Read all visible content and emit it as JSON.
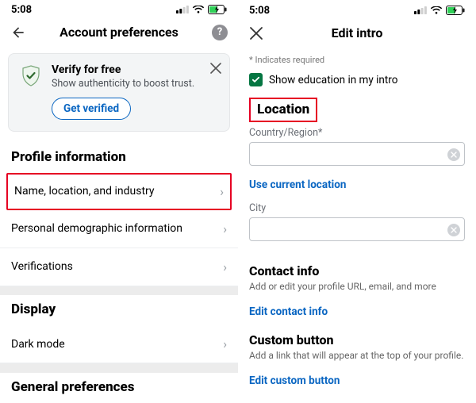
{
  "status_bar": {
    "time": "5:08"
  },
  "left": {
    "nav_title": "Account preferences",
    "verify": {
      "title": "Verify for free",
      "subtitle": "Show authenticity to boost trust.",
      "button": "Get verified"
    },
    "sections": {
      "profile_heading": "Profile information",
      "rows": {
        "name_location": "Name, location, and industry",
        "demographic": "Personal demographic information",
        "verifications": "Verifications"
      },
      "display_heading": "Display",
      "dark_mode": "Dark mode",
      "general_heading": "General preferences"
    }
  },
  "right": {
    "nav_title": "Edit intro",
    "required_note": "* Indicates required",
    "show_education_label": "Show education in my intro",
    "location_heading": "Location",
    "country_label": "Country/Region*",
    "country_value": "",
    "use_current_location": "Use current location",
    "city_label": "City",
    "city_value": "",
    "contact_heading": "Contact info",
    "contact_desc": "Add or edit your profile URL, email, and more",
    "edit_contact": "Edit contact info",
    "custom_heading": "Custom button",
    "custom_desc": "Add a link that will appear at the top of your profile.",
    "edit_custom": "Edit custom button"
  }
}
